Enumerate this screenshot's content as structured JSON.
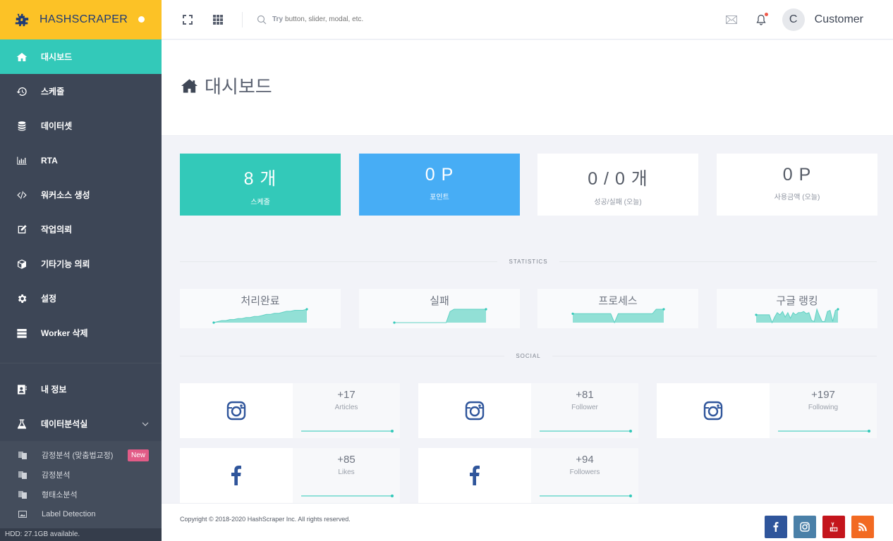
{
  "brand": {
    "name": "HASHSCRAPER"
  },
  "sidebar": {
    "items": [
      {
        "label": "대시보드",
        "icon": "home-icon",
        "active": true
      },
      {
        "label": "스케줄",
        "icon": "history-icon"
      },
      {
        "label": "데이터셋",
        "icon": "database-icon"
      },
      {
        "label": "RTA",
        "icon": "bar-chart-icon"
      },
      {
        "label": "워커소스 생성",
        "icon": "code-icon"
      },
      {
        "label": "작업의뢰",
        "icon": "edit-icon"
      },
      {
        "label": "기타기능 의뢰",
        "icon": "cube-icon"
      },
      {
        "label": "설정",
        "icon": "gear-icon"
      },
      {
        "label": "Worker 삭제",
        "icon": "server-icon"
      }
    ],
    "lower_items": [
      {
        "label": "내 정보",
        "icon": "contact-card-icon"
      },
      {
        "label": "데이터분석실",
        "icon": "flask-icon",
        "expanded": true
      }
    ],
    "sub_items": [
      {
        "label": "감정분석 (맞춤법교정)",
        "icon": "translate-icon",
        "badge": "New"
      },
      {
        "label": "감정분석",
        "icon": "translate-icon"
      },
      {
        "label": "형태소분석",
        "icon": "translate-icon"
      },
      {
        "label": "Label Detection",
        "icon": "image-icon"
      }
    ],
    "hdd_status": "HDD: 27.1GB available."
  },
  "topbar": {
    "search_try": "Try",
    "search_placeholder": "button, slider, modal, etc.",
    "user_initial": "C",
    "user_name": "Customer",
    "notification_dot": true
  },
  "page": {
    "title": "대시보드"
  },
  "stats": [
    {
      "value": "8 개",
      "label": "스케줄",
      "color": "#33c9b9"
    },
    {
      "value": "0 P",
      "label": "포인트",
      "color": "#47adf5"
    },
    {
      "value": "0 / 0 개",
      "label": "성공/실패 (오늘)",
      "color": "#ffffff"
    },
    {
      "value": "0 P",
      "label": "사용금액 (오늘)",
      "color": "#ffffff"
    }
  ],
  "sections": {
    "statistics": "STATISTICS",
    "social": "SOCIAL"
  },
  "sparklines": [
    {
      "title": "처리완료",
      "values": [
        0,
        1,
        2,
        2,
        3,
        3,
        4,
        4,
        5,
        5,
        6,
        6,
        7,
        8,
        8,
        9,
        9,
        10,
        11,
        11,
        12,
        12,
        12,
        13
      ]
    },
    {
      "title": "실패",
      "values": [
        0,
        0,
        0,
        0,
        0,
        0,
        0,
        0,
        0,
        0,
        0,
        0,
        0,
        0,
        10,
        12,
        12,
        12,
        12,
        12,
        12,
        12,
        12,
        12
      ]
    },
    {
      "title": "프로세스",
      "values": [
        8,
        8,
        8,
        8,
        8,
        8,
        8,
        8,
        8,
        8,
        8,
        0,
        8,
        8,
        8,
        8,
        8,
        8,
        8,
        8,
        8,
        8,
        12,
        12,
        12
      ]
    },
    {
      "title": "구글 랭킹",
      "values": [
        7,
        7,
        7,
        7,
        7,
        7,
        0,
        5,
        9,
        7,
        10,
        5,
        9,
        4,
        9,
        7,
        9,
        9,
        10,
        8,
        9,
        2,
        1,
        12,
        6,
        1,
        1,
        10,
        11,
        1,
        11,
        12
      ]
    }
  ],
  "social": [
    {
      "network": "instagram",
      "icon": "instagram-icon",
      "value": "+17",
      "label": "Articles"
    },
    {
      "network": "instagram",
      "icon": "instagram-icon",
      "value": "+81",
      "label": "Follower"
    },
    {
      "network": "instagram",
      "icon": "instagram-icon",
      "value": "+197",
      "label": "Following"
    },
    {
      "network": "facebook",
      "icon": "facebook-icon",
      "value": "+85",
      "label": "Likes"
    },
    {
      "network": "facebook",
      "icon": "facebook-icon",
      "value": "+94",
      "label": "Followers"
    }
  ],
  "footer": {
    "copyright": "Copyright © 2018-2020 HashScraper Inc. All rights reserved.",
    "links": [
      {
        "name": "facebook",
        "color": "#2f559b"
      },
      {
        "name": "instagram",
        "color": "#4a80a8"
      },
      {
        "name": "youtube",
        "color": "#c4151c"
      },
      {
        "name": "rss",
        "color": "#f26a22"
      }
    ]
  },
  "colors": {
    "accent": "#33c9b9",
    "brand": "#fcc226",
    "sidebar": "#3d4656",
    "blue": "#47adf5"
  }
}
